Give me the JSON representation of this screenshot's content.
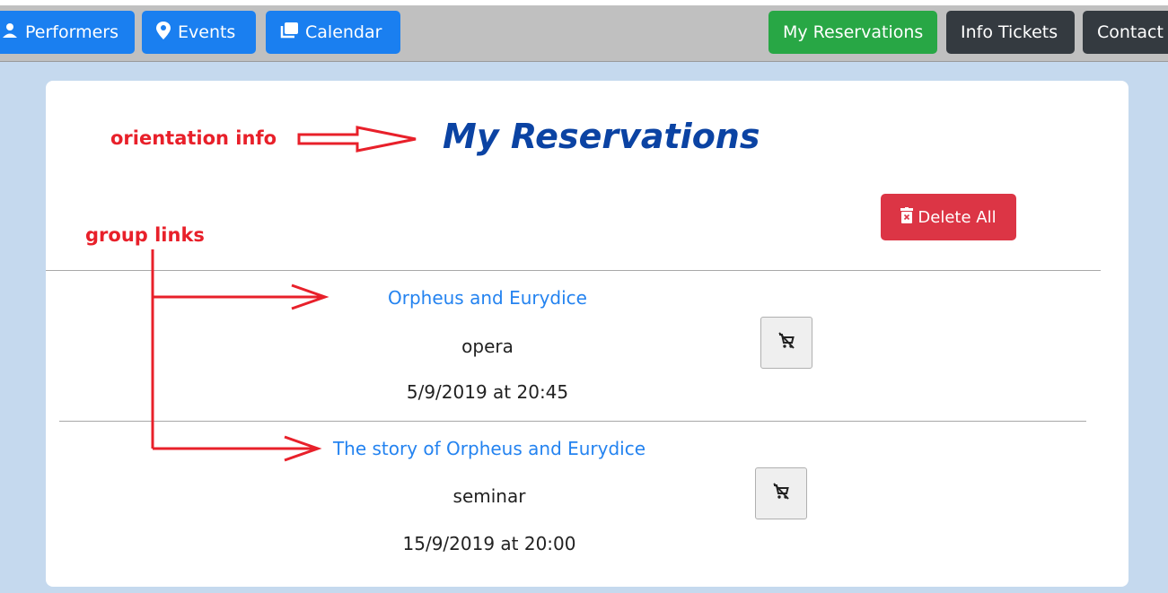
{
  "nav": {
    "performers": "Performers",
    "events": "Events",
    "calendar": "Calendar",
    "my_reservations": "My Reservations",
    "info_tickets": "Info Tickets",
    "contact": "Contact"
  },
  "page": {
    "title": "My Reservations",
    "delete_all": "Delete All"
  },
  "annotations": {
    "orientation": "orientation info",
    "group_links": "group links"
  },
  "reservations": [
    {
      "title": "Orpheus and Eurydice",
      "type": "opera",
      "datetime": "5/9/2019 at 20:45"
    },
    {
      "title": "The story of Orpheus and Eurydice",
      "type": "seminar",
      "datetime": "15/9/2019 at 20:00"
    }
  ],
  "colors": {
    "primary": "#1a7ff0",
    "success": "#28a745",
    "dark": "#343a40",
    "danger": "#dc3545",
    "title": "#0b43a3",
    "annotation": "#e8202a",
    "link": "#2483f0"
  },
  "icons": {
    "performers": "person-icon",
    "events": "map-pin-icon",
    "calendar": "collection-icon",
    "delete_all": "trash-icon",
    "remove": "cart-remove-icon"
  }
}
